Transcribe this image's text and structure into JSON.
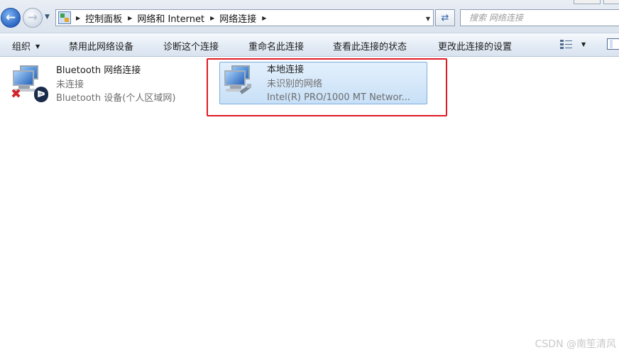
{
  "window": {
    "breadcrumb": [
      "控制面板",
      "网络和 Internet",
      "网络连接"
    ],
    "search_placeholder": "搜索 网络连接"
  },
  "toolbar": {
    "organize": "组织",
    "disable": "禁用此网络设备",
    "diagnose": "诊断这个连接",
    "rename": "重命名此连接",
    "status": "查看此连接的状态",
    "settings": "更改此连接的设置"
  },
  "connections": [
    {
      "name": "Bluetooth 网络连接",
      "status": "未连接",
      "device": "Bluetooth 设备(个人区域网)",
      "icons": [
        "network-monitors-icon",
        "disconnected-x-icon",
        "bluetooth-icon"
      ]
    },
    {
      "name": "本地连接",
      "status": "未识别的网络",
      "device": "Intel(R) PRO/1000 MT Networ...",
      "selected": true,
      "icons": [
        "network-monitors-icon",
        "ethernet-cable-icon"
      ]
    }
  ],
  "colors": {
    "selection_fill": "#c8e0f7",
    "selection_border": "#7daee0",
    "annotation_red": "#e01b24"
  },
  "watermark": "CSDN @南笙清风"
}
